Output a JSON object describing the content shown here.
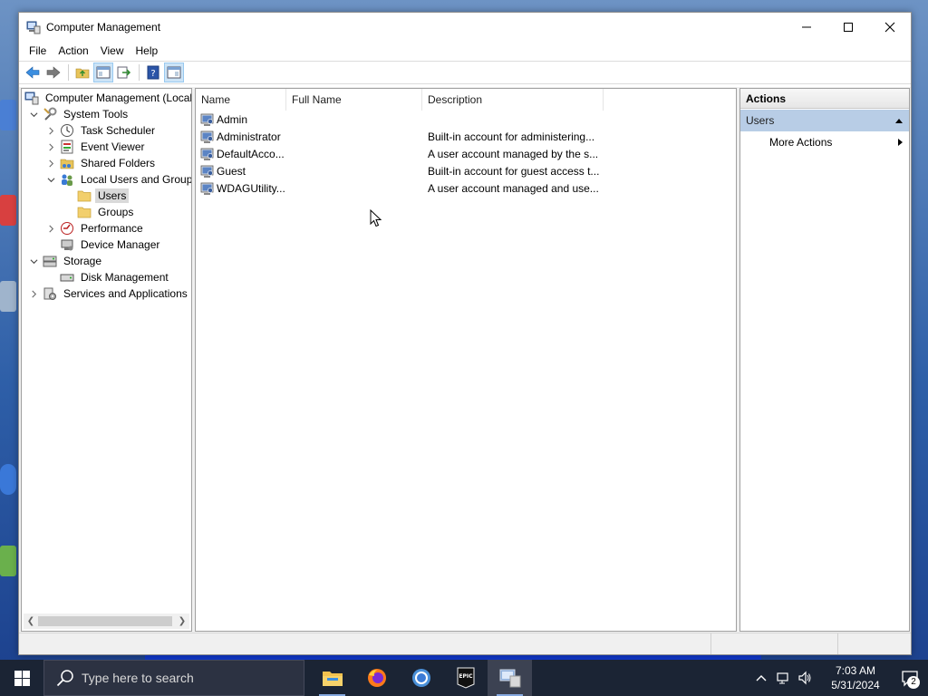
{
  "window": {
    "title": "Computer Management"
  },
  "menubar": {
    "items": [
      "File",
      "Action",
      "View",
      "Help"
    ]
  },
  "tree": {
    "items": [
      {
        "label": "Computer Management (Local",
        "icon": "computer-management-icon",
        "level": 0,
        "expander": "none"
      },
      {
        "label": "System Tools",
        "icon": "system-tools-icon",
        "level": 1,
        "expander": "expanded"
      },
      {
        "label": "Task Scheduler",
        "icon": "clock-icon",
        "level": 2,
        "expander": "collapsed"
      },
      {
        "label": "Event Viewer",
        "icon": "event-viewer-icon",
        "level": 2,
        "expander": "collapsed"
      },
      {
        "label": "Shared Folders",
        "icon": "shared-folder-icon",
        "level": 2,
        "expander": "collapsed"
      },
      {
        "label": "Local Users and Groups",
        "icon": "users-groups-icon",
        "level": 2,
        "expander": "expanded"
      },
      {
        "label": "Users",
        "icon": "folder-icon",
        "level": 3,
        "expander": "none",
        "selected": true
      },
      {
        "label": "Groups",
        "icon": "folder-icon",
        "level": 3,
        "expander": "none"
      },
      {
        "label": "Performance",
        "icon": "performance-icon",
        "level": 2,
        "expander": "collapsed"
      },
      {
        "label": "Device Manager",
        "icon": "device-manager-icon",
        "level": 2,
        "expander": "none"
      },
      {
        "label": "Storage",
        "icon": "storage-icon",
        "level": 1,
        "expander": "expanded"
      },
      {
        "label": "Disk Management",
        "icon": "disk-icon",
        "level": 2,
        "expander": "none"
      },
      {
        "label": "Services and Applications",
        "icon": "services-icon",
        "level": 1,
        "expander": "collapsed"
      }
    ]
  },
  "list": {
    "columns": [
      "Name",
      "Full Name",
      "Description"
    ],
    "rows": [
      {
        "name": "Admin",
        "full_name": "",
        "description": ""
      },
      {
        "name": "Administrator",
        "full_name": "",
        "description": "Built-in account for administering..."
      },
      {
        "name": "DefaultAcco...",
        "full_name": "",
        "description": "A user account managed by the s..."
      },
      {
        "name": "Guest",
        "full_name": "",
        "description": "Built-in account for guest access t..."
      },
      {
        "name": "WDAGUtility...",
        "full_name": "",
        "description": "A user account managed and use..."
      }
    ]
  },
  "actions": {
    "title": "Actions",
    "section": "Users",
    "items": [
      "More Actions"
    ]
  },
  "taskbar": {
    "search_placeholder": "Type here to search",
    "apps": [
      "file-explorer-icon",
      "firefox-icon",
      "chrome-icon",
      "epic-games-icon",
      "computer-management-icon"
    ],
    "time": "7:03 AM",
    "date": "5/31/2024",
    "notification_count": "2"
  },
  "colors": {
    "selection": "#d9d9d9",
    "actions_section": "#b8cde6",
    "taskbar": "#1b2434"
  }
}
